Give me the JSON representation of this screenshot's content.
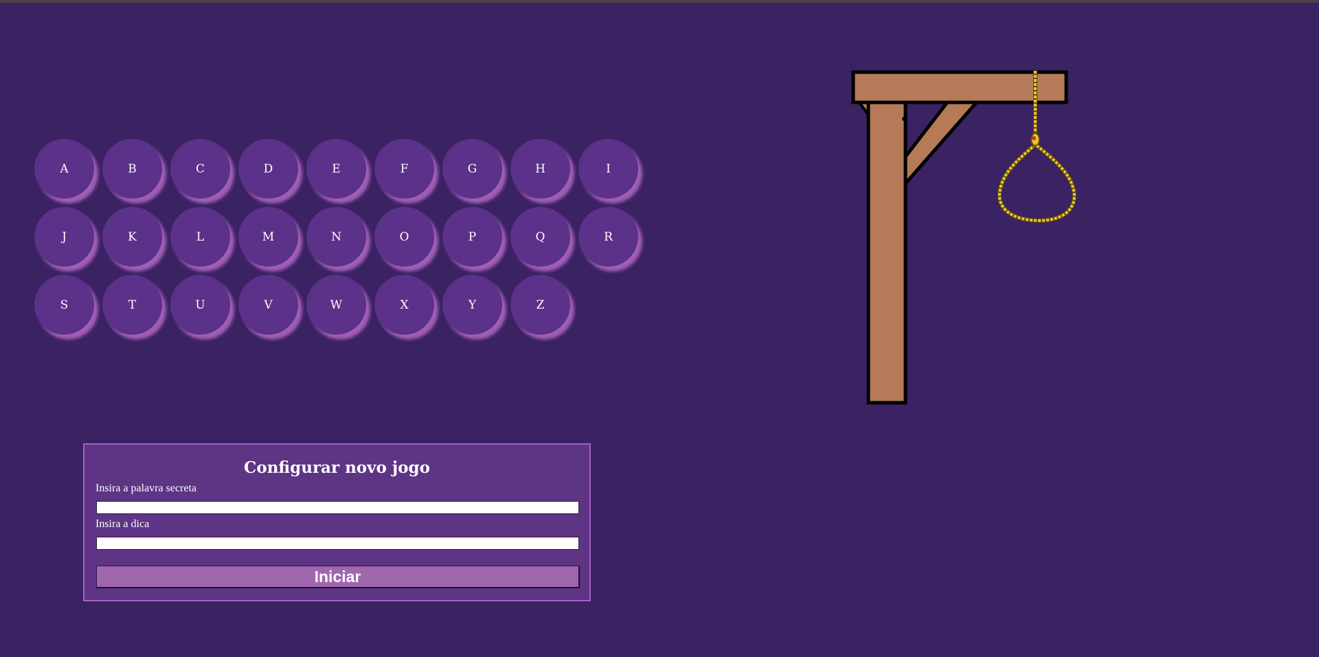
{
  "keyboard": {
    "rows": [
      [
        "A",
        "B",
        "C",
        "D",
        "E",
        "F",
        "G",
        "H",
        "I"
      ],
      [
        "J",
        "K",
        "L",
        "M",
        "N",
        "O",
        "P",
        "Q",
        "R"
      ],
      [
        "S",
        "T",
        "U",
        "V",
        "W",
        "X",
        "Y",
        "Z"
      ]
    ]
  },
  "setup": {
    "title": "Configurar novo jogo",
    "secret_label": "Insira a palavra secreta",
    "secret_value": "",
    "hint_label": "Insira a dica",
    "hint_value": "",
    "start_label": "Iniciar"
  },
  "colors": {
    "background": "#3b2263",
    "key": "#5c3189",
    "key_shadow": "#a05eb5",
    "panel": "#5e3485",
    "button": "#a066ae",
    "wood": "#b57a58",
    "rope": "#e8c62a"
  },
  "icons": {
    "gallows": "gallows-icon",
    "noose": "noose-icon"
  }
}
